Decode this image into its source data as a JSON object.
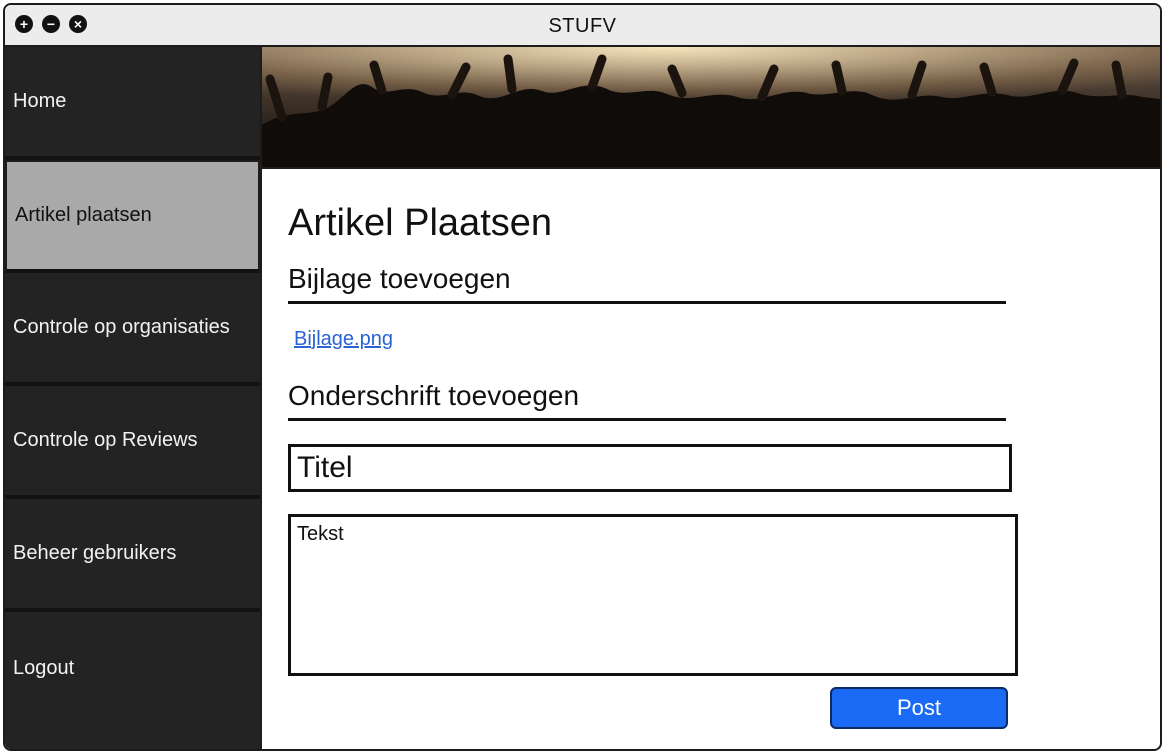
{
  "window": {
    "title": "STUFV",
    "controls": [
      {
        "name": "plus-icon",
        "glyph": "+"
      },
      {
        "name": "minus-icon",
        "glyph": "−"
      },
      {
        "name": "close-icon",
        "glyph": "×"
      }
    ]
  },
  "sidebar": {
    "items": [
      {
        "label": "Home",
        "active": false
      },
      {
        "label": "Artikel plaatsen",
        "active": true
      },
      {
        "label": "Controle op organisaties",
        "active": false
      },
      {
        "label": "Controle op Reviews",
        "active": false
      },
      {
        "label": "Beheer gebruikers",
        "active": false
      },
      {
        "label": "Logout",
        "active": false
      }
    ]
  },
  "main": {
    "page_title": "Artikel Plaatsen",
    "attachment_heading": "Bijlage toevoegen",
    "attachment_link": "Bijlage.png",
    "caption_heading": "Onderschrift toevoegen",
    "title_field": {
      "value": "Titel"
    },
    "text_field": {
      "value": "Tekst"
    },
    "post_button": "Post"
  },
  "colors": {
    "sidebar_bg": "#232323",
    "sidebar_active_bg": "#a9a9a9",
    "link": "#2a63d3",
    "post_button_bg": "#1a6af5"
  }
}
